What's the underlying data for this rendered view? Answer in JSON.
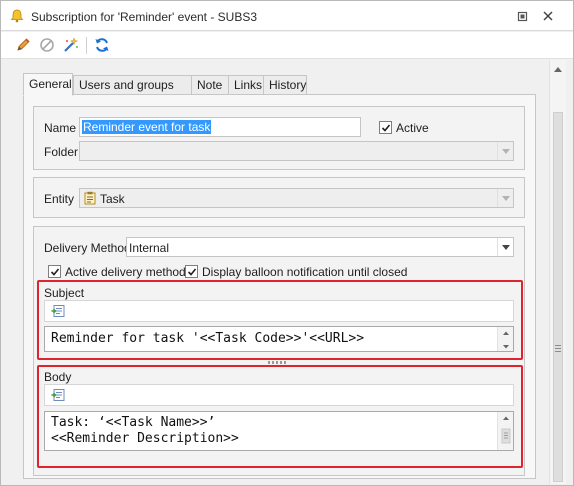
{
  "window": {
    "title": "Subscription for 'Reminder' event - SUBS3",
    "title_icon": "bell-icon",
    "buttons": [
      "restore-icon",
      "close-icon"
    ]
  },
  "toolbar": {
    "tools": [
      "edit-pencil-icon",
      "disable-icon",
      "magic-wand-icon",
      "refresh-icon"
    ]
  },
  "tabs": [
    {
      "label": "General",
      "active": true
    },
    {
      "label": "Users and groups",
      "active": false
    },
    {
      "label": "Note",
      "active": false
    },
    {
      "label": "Links",
      "active": false
    },
    {
      "label": "History",
      "active": false
    }
  ],
  "general": {
    "name_label": "Name",
    "name_value": "Reminder event for task",
    "active_label": "Active",
    "active_checked": true,
    "folder_label": "Folder",
    "folder_value": "",
    "entity_label": "Entity",
    "entity_value": "Task",
    "entity_icon": "task-clipboard-icon",
    "delivery_method_label": "Delivery Method",
    "delivery_method_value": "Internal",
    "active_delivery_label": "Active delivery method",
    "active_delivery_checked": true,
    "balloon_label": "Display balloon notification until closed",
    "balloon_checked": true
  },
  "subject": {
    "header": "Subject",
    "insert_field_icon": "insert-field-icon",
    "text": "Reminder for task '<<Task Code>>'<<URL>>"
  },
  "body": {
    "header": "Body",
    "insert_field_icon": "insert-field-icon",
    "line1": "Task: ‘<<Task Name>>’",
    "line2": "<<Reminder Description>>"
  },
  "colors": {
    "highlight": "#e0242f",
    "selection": "#3399ff",
    "accent_blue": "#1c6fd1"
  }
}
